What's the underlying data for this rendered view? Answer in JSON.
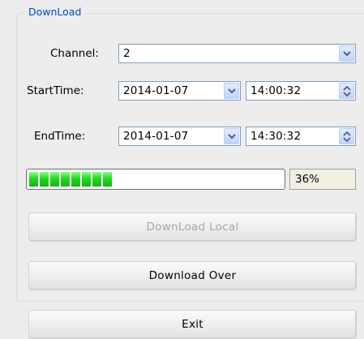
{
  "group": {
    "title": "DownLoad"
  },
  "channel": {
    "label": "Channel:",
    "value": "2"
  },
  "start_time": {
    "label": "StartTime:",
    "date": "2014-01-07",
    "time": "14:00:32"
  },
  "end_time": {
    "label": "EndTime:",
    "date": "2014-01-07",
    "time": "14:30:32"
  },
  "progress": {
    "fraction": 0.36,
    "percent_text": "36%",
    "fill_color": "#22d822"
  },
  "buttons": {
    "download_local": "DownLoad Local",
    "download_over": "Download Over",
    "exit": "Exit"
  },
  "colors": {
    "group_title": "#0046d5",
    "disabled_text": "#a7a7a7",
    "dialog_bg": "#ededed"
  }
}
